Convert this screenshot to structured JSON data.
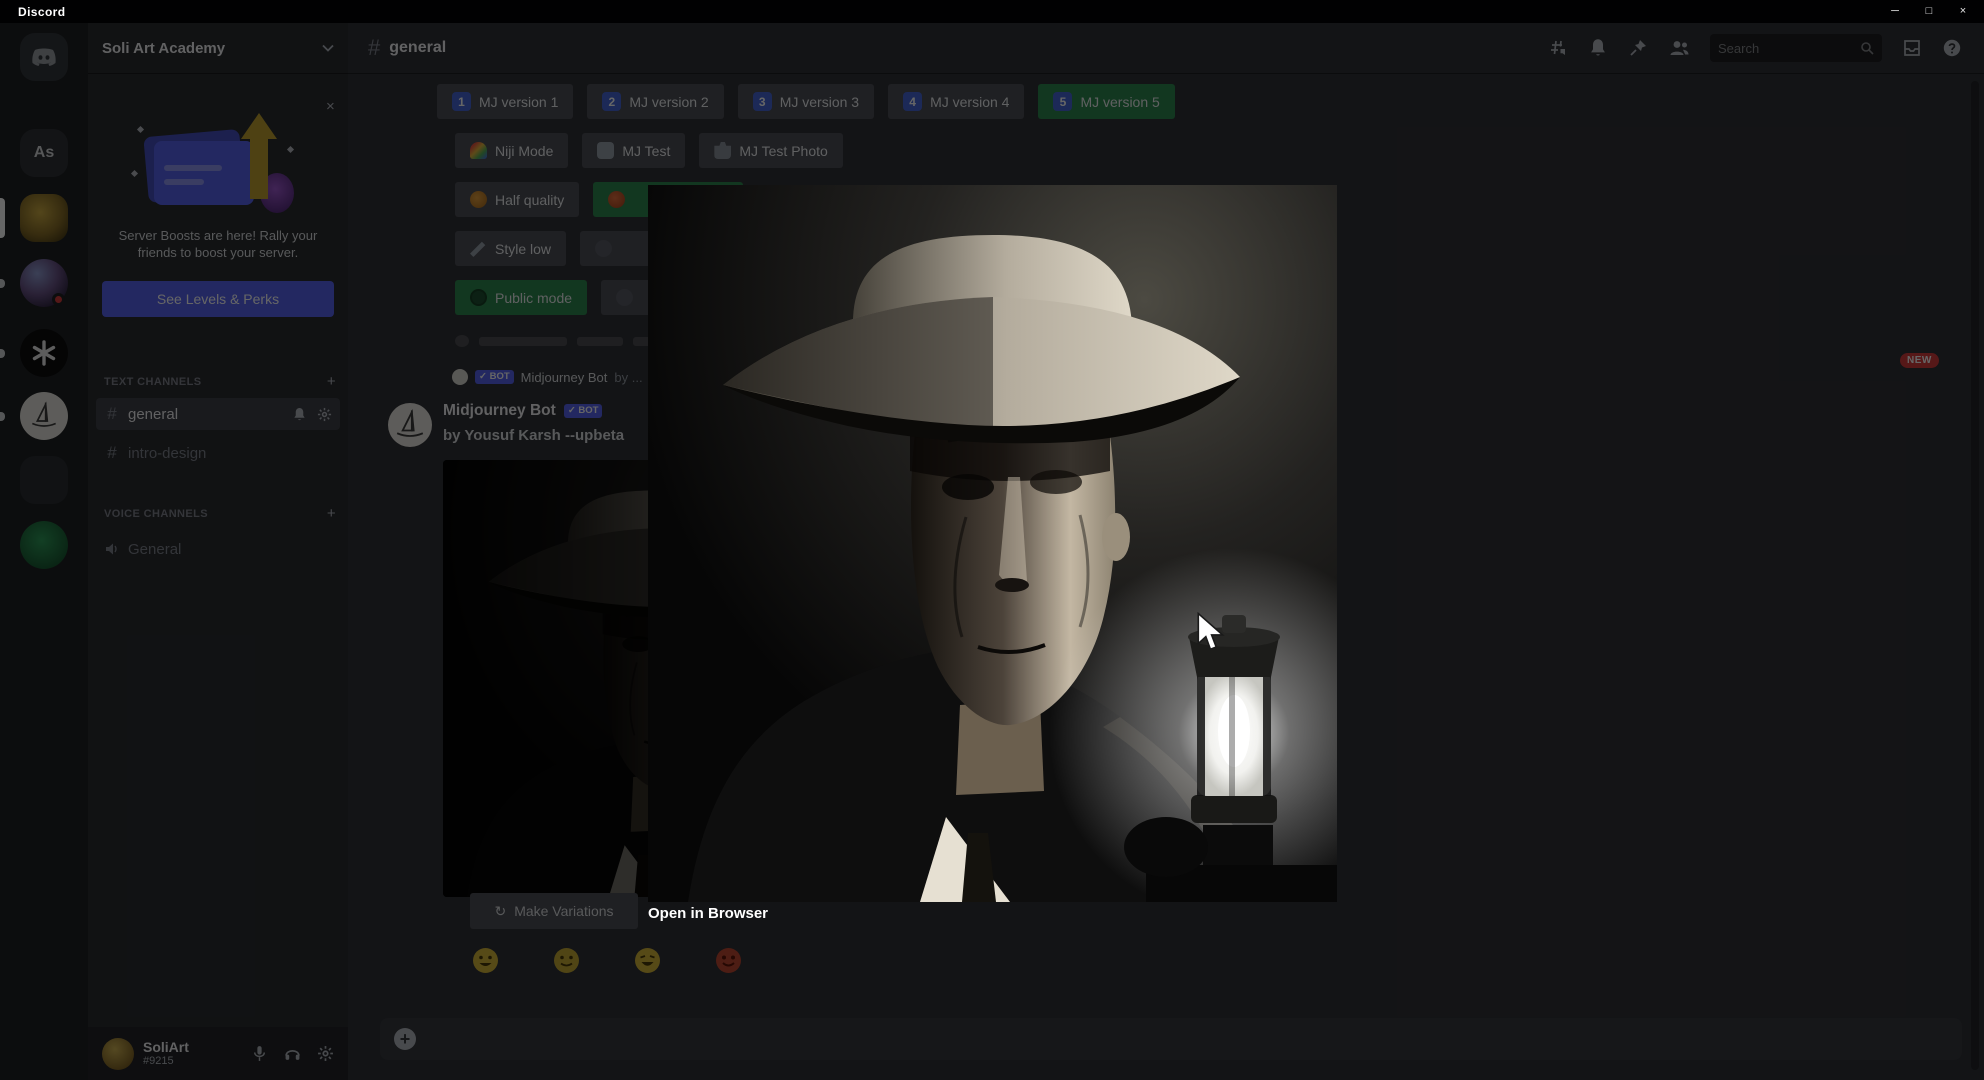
{
  "titlebar": {
    "app_name": "Discord"
  },
  "window_controls": {
    "minimize": "─",
    "maximize": "□",
    "close": "×"
  },
  "glyphs": {
    "hash": "#",
    "plus": "+",
    "close": "×",
    "question": "?",
    "refresh": "↻",
    "plus_attach": "+"
  },
  "rail": {
    "server_as_initials": "As"
  },
  "sidebar": {
    "server_name": "Soli Art Academy",
    "boost_message": "Server Boosts are here! Rally your friends to boost your server.",
    "boost_cta": "See Levels & Perks",
    "text_channels_label": "TEXT CHANNELS",
    "voice_channels_label": "VOICE CHANNELS",
    "channel_general": "general",
    "channel_design": "intro-design",
    "voice_general": "General",
    "user_name": "SoliArt",
    "user_tag": "#9215"
  },
  "chat_header": {
    "channel_name": "general",
    "search_placeholder": "Search"
  },
  "settings": {
    "row1": [
      {
        "num": "1",
        "label": "MJ version 1"
      },
      {
        "num": "2",
        "label": "MJ version 2"
      },
      {
        "num": "3",
        "label": "MJ version 3"
      },
      {
        "num": "4",
        "label": "MJ version 4"
      },
      {
        "num": "5",
        "label": "MJ version 5"
      }
    ],
    "row2": [
      {
        "label": "Niji Mode"
      },
      {
        "label": "MJ Test"
      },
      {
        "label": "MJ Test Photo"
      }
    ],
    "row3": [
      {
        "label": "Half quality"
      }
    ],
    "row4": [
      {
        "label": "Style low"
      }
    ],
    "row5": [
      {
        "label": "Public mode"
      }
    ]
  },
  "message": {
    "reply_author": "Midjourney Bot",
    "bot_badge": "✓ BOT",
    "reply_preview": "by ...",
    "author": "Midjourney Bot",
    "content": "by Yousuf Karsh --upbeta",
    "new_badge": "NEW"
  },
  "attachment_actions": {
    "make_variations": "Make Variations"
  },
  "lightbox": {
    "open_in_browser": "Open in Browser"
  },
  "colors": {
    "accent_green": "#2d8a50",
    "blurple": "#5865f2",
    "danger_red": "#d83c3e"
  }
}
